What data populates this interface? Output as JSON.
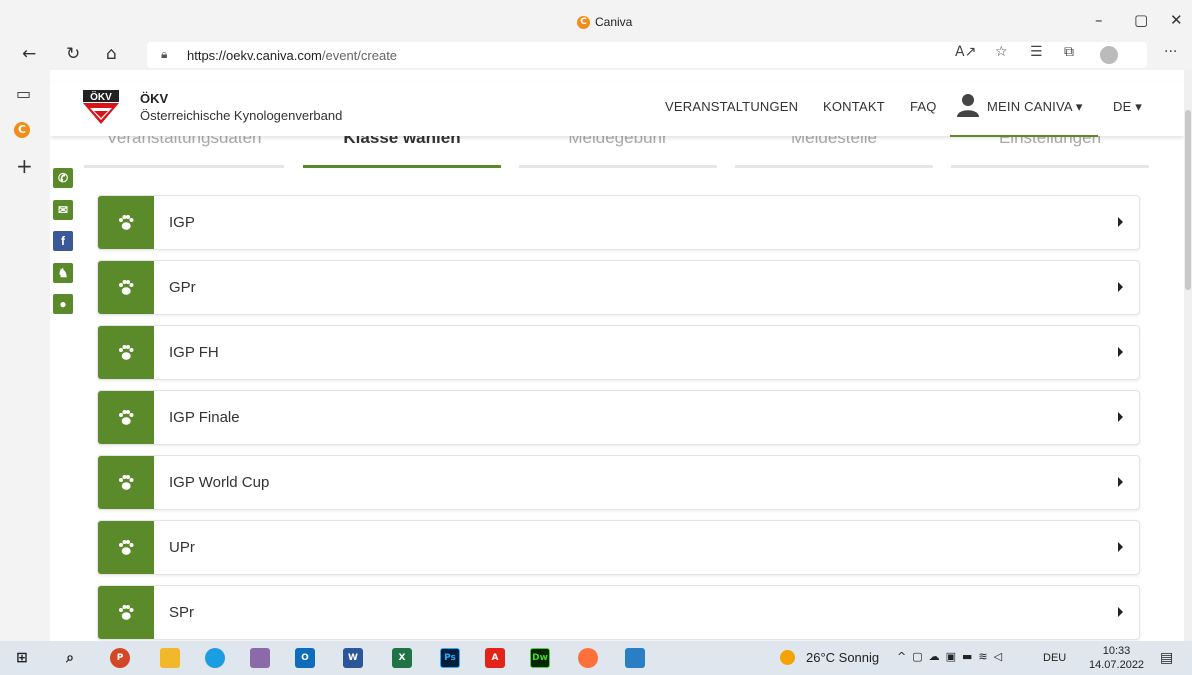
{
  "browser": {
    "window_title": "Caniva",
    "url_host": "https://oekv.caniva.com",
    "url_path": "/event/create"
  },
  "header": {
    "org_abbr": "ÖKV",
    "org_name": "Österreichische Kynologenverband",
    "nav": {
      "events": "VERANSTALTUNGEN",
      "contact": "KONTAKT",
      "faq": "FAQ",
      "account": "MEIN CANIVA",
      "language": "DE"
    }
  },
  "steps": [
    {
      "label": "Veranstaltungsdaten",
      "active": false
    },
    {
      "label": "Klasse wählen",
      "active": true
    },
    {
      "label": "Meldegebühr",
      "active": false
    },
    {
      "label": "Meldestelle",
      "active": false
    },
    {
      "label": "Einstellungen",
      "active": false
    }
  ],
  "classes": [
    {
      "label": "IGP"
    },
    {
      "label": "GPr"
    },
    {
      "label": "IGP FH"
    },
    {
      "label": "IGP Finale"
    },
    {
      "label": "IGP World Cup"
    },
    {
      "label": "UPr"
    },
    {
      "label": "SPr"
    }
  ],
  "taskbar": {
    "weather": "26°C Sonnig",
    "language": "DEU",
    "time": "10:33",
    "date": "14.07.2022"
  },
  "colors": {
    "accent_green": "#5b8a2a",
    "logo_red": "#d7141a",
    "facebook_blue": "#3b5998"
  }
}
